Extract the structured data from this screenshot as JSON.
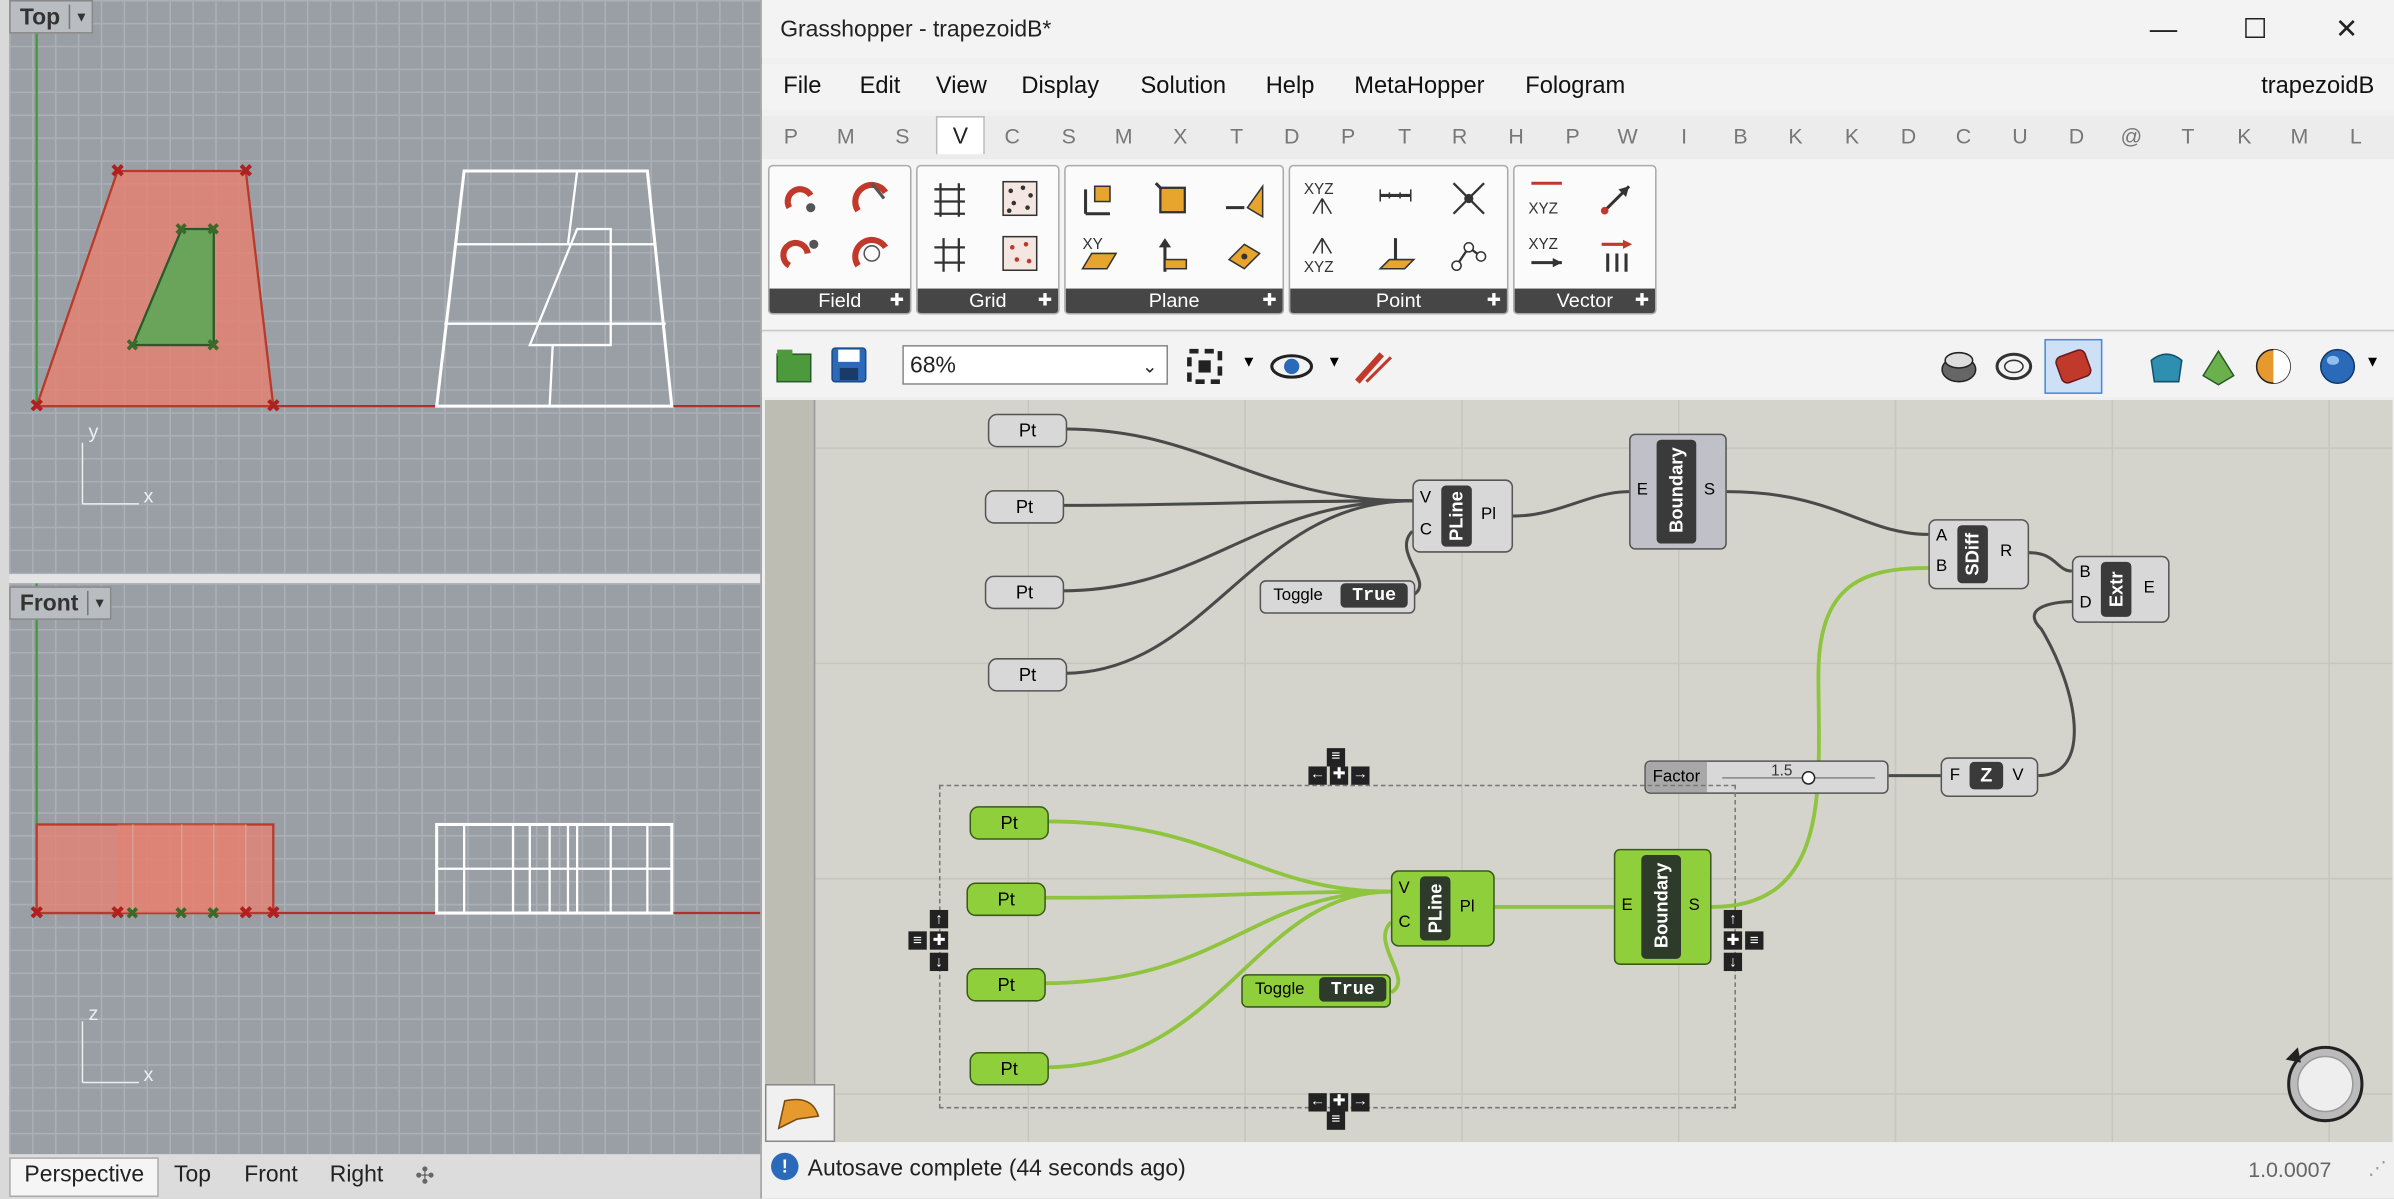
{
  "rhino": {
    "viewport_top": {
      "label": "Top",
      "axis_x": "x",
      "axis_y": "y"
    },
    "viewport_front": {
      "label": "Front",
      "axis_x": "x",
      "axis_z": "z"
    },
    "bottom_tabs": [
      "Perspective",
      "Top",
      "Front",
      "Right"
    ],
    "add_tab_icon": "plus-icon"
  },
  "gh": {
    "title": "Grasshopper - trapezoidB*",
    "doc_name": "trapezoidB",
    "menu": [
      "File",
      "Edit",
      "View",
      "Display",
      "Solution",
      "Help",
      "MetaHopper",
      "Fologram"
    ],
    "tabs": [
      "P",
      "M",
      "S",
      "V",
      "C",
      "S",
      "M",
      "X",
      "T",
      "D",
      "P",
      "T",
      "R",
      "H",
      "P",
      "W",
      "I",
      "B",
      "K",
      "K",
      "D",
      "C",
      "U",
      "D",
      "@",
      "T",
      "K",
      "M",
      "L"
    ],
    "selected_tab_index": 3,
    "panels": [
      "Field",
      "Grid",
      "Plane",
      "Point",
      "Vector"
    ],
    "zoom": "68%",
    "status_message": "Autosave complete (44 seconds ago)",
    "version": "1.0.0007",
    "components": {
      "pt": "Pt",
      "pline": "PLine",
      "pline_in_v": "V",
      "pline_in_c": "C",
      "pline_out": "Pl",
      "boundary": "Boundary",
      "boundary_in": "E",
      "boundary_out": "S",
      "toggle": "Toggle",
      "toggle_value": "True",
      "sdiff": "SDiff",
      "sdiff_in_a": "A",
      "sdiff_in_b": "B",
      "sdiff_out": "R",
      "extr": "Extr",
      "extr_in_b": "B",
      "extr_in_d": "D",
      "extr_out": "E",
      "factor": "Factor",
      "factor_value": "1.5",
      "unit_z": "Z",
      "unit_in": "F",
      "unit_out": "V"
    }
  },
  "colors": {
    "gray_component": "#c8c8c8",
    "green_component": "#8fcf3c",
    "selected_fill": "#e8806f",
    "inner_fill": "#6aa45a",
    "wire_dark": "#4a4a4a",
    "wire_green": "#8fc43e"
  }
}
